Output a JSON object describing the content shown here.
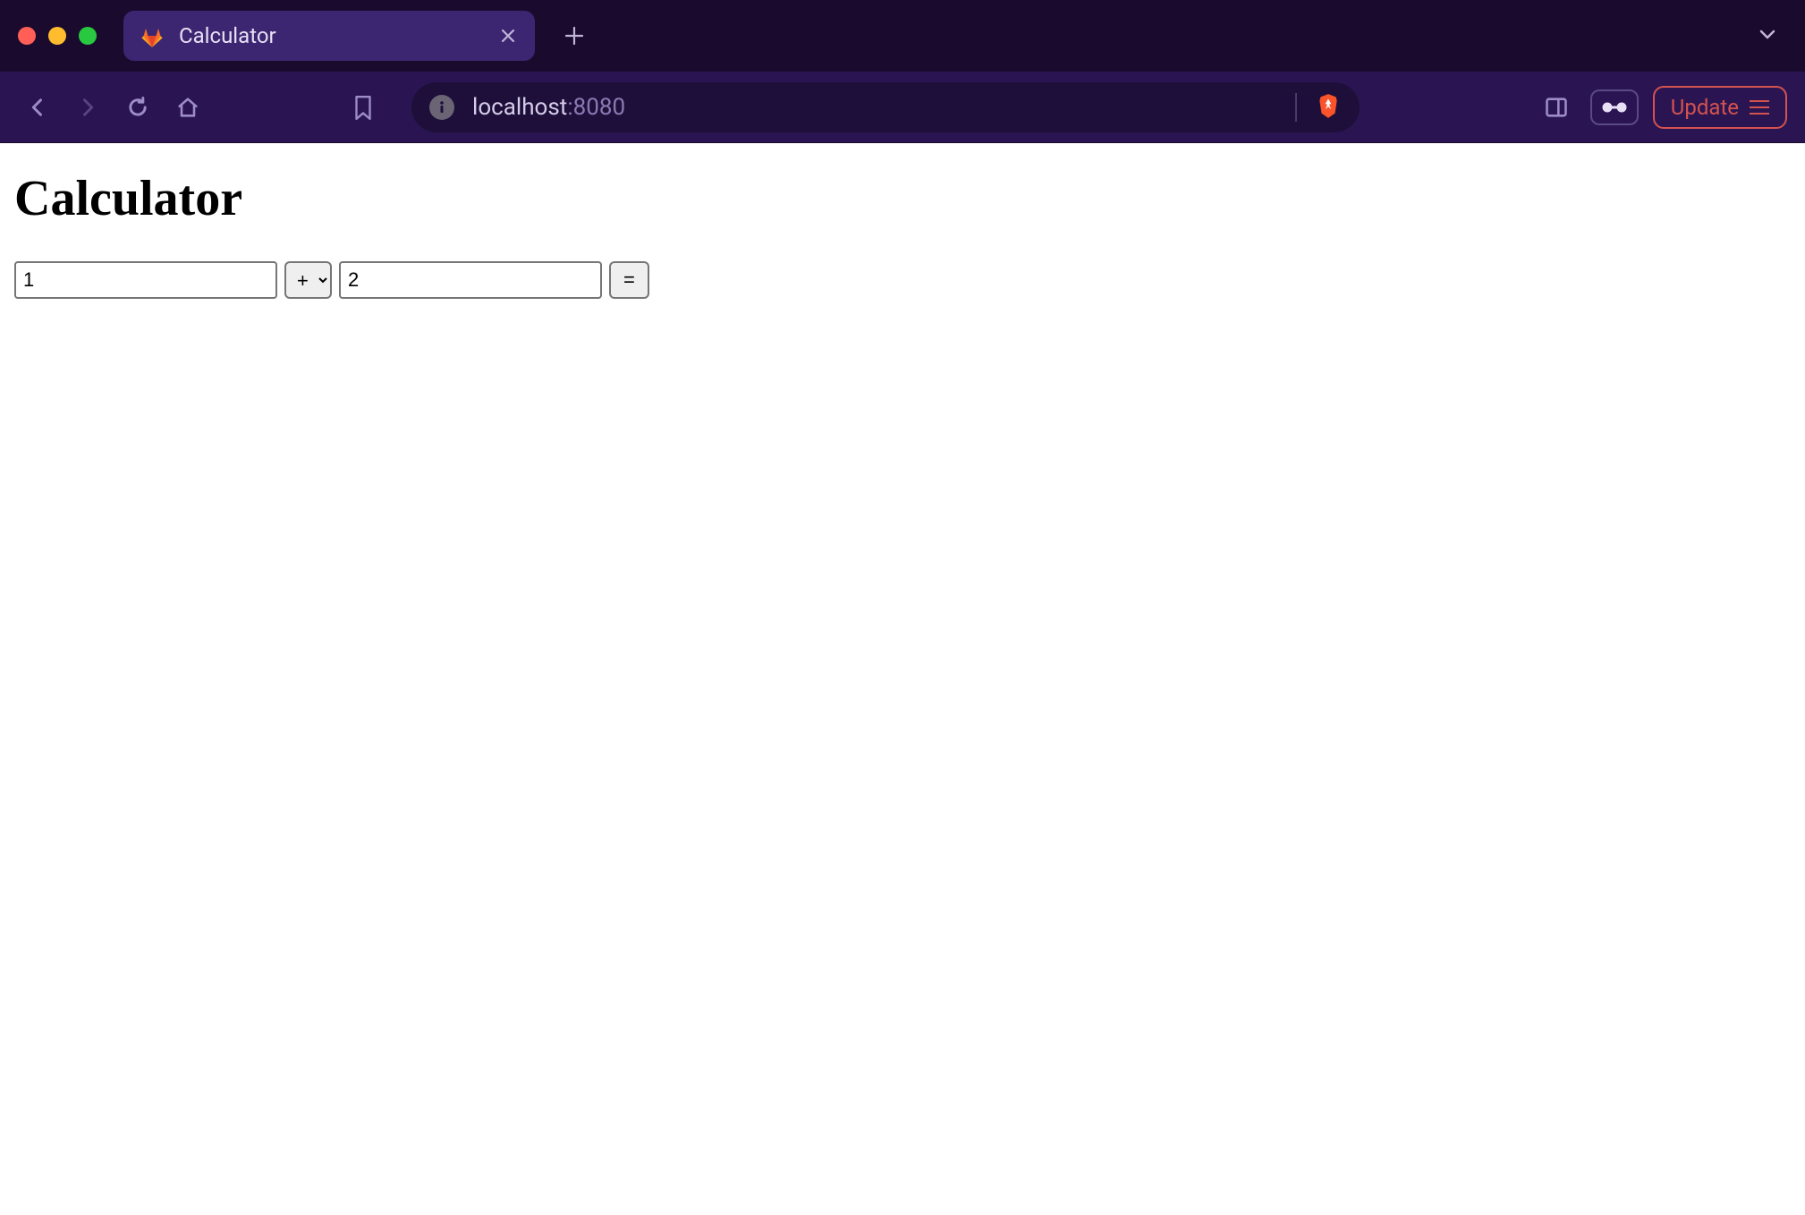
{
  "browser": {
    "tab_title": "Calculator",
    "url_host": "localhost",
    "url_port": ":8080",
    "update_label": "Update"
  },
  "page": {
    "heading": "Calculator",
    "operand1": "1",
    "operand2": "2",
    "operator_selected": "+",
    "equals_label": "="
  }
}
